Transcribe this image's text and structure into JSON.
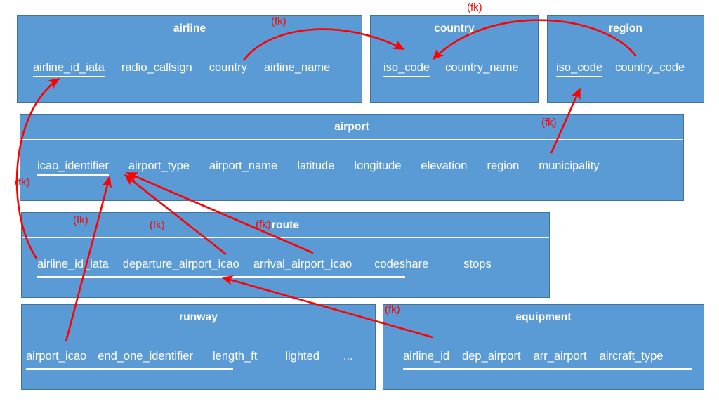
{
  "diagram": {
    "type": "entity-relationship-diagram",
    "title": "",
    "colors": {
      "entity_fill": "#5B9BD5",
      "entity_border": "#41719C",
      "text": "#FFFFFF",
      "relationship": "#FF0000"
    },
    "fk_label": "(fk)"
  },
  "entities": [
    {
      "name": "airline",
      "title": "airline",
      "attributes": [
        {
          "label": "airline_id_iata",
          "key": true
        },
        {
          "label": "radio_callsign",
          "key": false
        },
        {
          "label": "country",
          "key": false
        },
        {
          "label": "airline_name",
          "key": false
        }
      ]
    },
    {
      "name": "country",
      "title": "country",
      "attributes": [
        {
          "label": "iso_code",
          "key": true
        },
        {
          "label": "country_name",
          "key": false
        }
      ]
    },
    {
      "name": "region",
      "title": "region",
      "attributes": [
        {
          "label": "iso_code",
          "key": true
        },
        {
          "label": "country_code",
          "key": false
        }
      ]
    },
    {
      "name": "airport",
      "title": "airport",
      "attributes": [
        {
          "label": "icao_identifier",
          "key": true
        },
        {
          "label": "airport_type",
          "key": false
        },
        {
          "label": "airport_name",
          "key": false
        },
        {
          "label": "latitude",
          "key": false
        },
        {
          "label": "longitude",
          "key": false
        },
        {
          "label": "elevation",
          "key": false
        },
        {
          "label": "region",
          "key": false
        },
        {
          "label": "municipality",
          "key": false
        }
      ]
    },
    {
      "name": "route",
      "title": "route",
      "attributes": [
        {
          "label": "airline_id_iata",
          "key": true
        },
        {
          "label": "departure_airport_icao",
          "key": true
        },
        {
          "label": "arrival_airport_icao",
          "key": true
        },
        {
          "label": "codeshare",
          "key": false
        },
        {
          "label": "stops",
          "key": false
        }
      ]
    },
    {
      "name": "runway",
      "title": "runway",
      "attributes": [
        {
          "label": "airport_icao",
          "key": true
        },
        {
          "label": "end_one_identifier",
          "key": true
        },
        {
          "label": "length_ft",
          "key": false
        },
        {
          "label": "lighted",
          "key": false
        },
        {
          "label": "...",
          "key": false
        }
      ]
    },
    {
      "name": "equipment",
      "title": "equipment",
      "attributes": [
        {
          "label": "airline_id",
          "key": true
        },
        {
          "label": "dep_airport",
          "key": true
        },
        {
          "label": "arr_airport",
          "key": true
        },
        {
          "label": "aircraft_type",
          "key": true
        }
      ]
    }
  ],
  "relationships": [
    {
      "from": "airline.country",
      "to": "country.iso_code",
      "label": "(fk)"
    },
    {
      "from": "region.country_code",
      "to": "country.iso_code",
      "label": "(fk)"
    },
    {
      "from": "airport.region",
      "to": "region.iso_code",
      "label": "(fk)"
    },
    {
      "from": "route.airline_id_iata",
      "to": "airline.airline_id_iata",
      "label": "(fk)"
    },
    {
      "from": "route.departure_airport_icao",
      "to": "airport.icao_identifier",
      "label": "(fk)"
    },
    {
      "from": "route.arrival_airport_icao",
      "to": "airport.icao_identifier",
      "label": "(fk)"
    },
    {
      "from": "runway.airport_icao",
      "to": "airport.icao_identifier",
      "label": "(fk)"
    },
    {
      "from": "equipment",
      "to": "route",
      "label": "(fk)"
    }
  ]
}
